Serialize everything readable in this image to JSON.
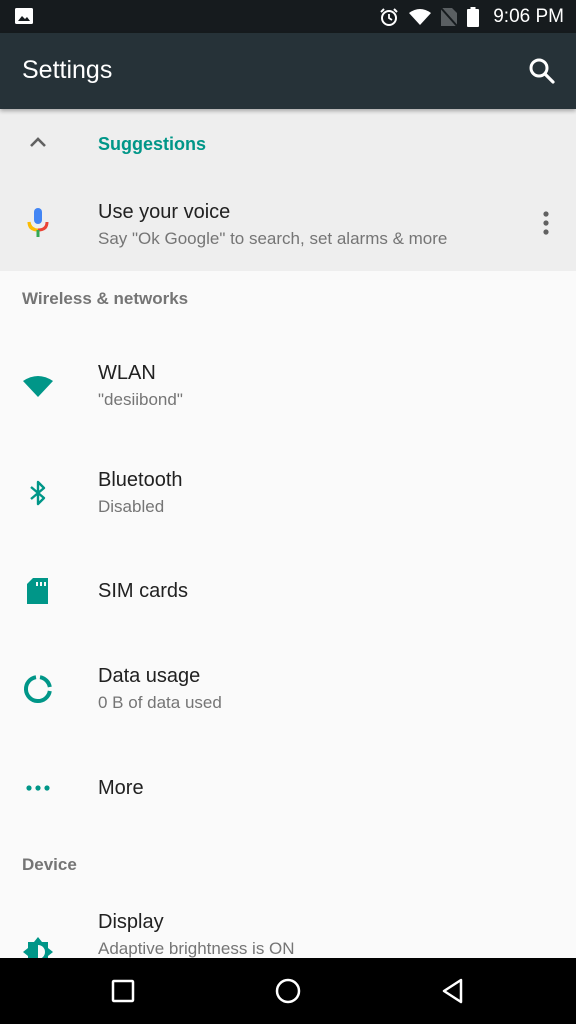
{
  "status_bar": {
    "time": "9:06 PM",
    "icons": [
      "image-notification-icon",
      "alarm-icon",
      "wifi-icon",
      "no-sim-icon",
      "battery-icon"
    ]
  },
  "app_bar": {
    "title": "Settings",
    "search_icon": "search-icon"
  },
  "suggestions": {
    "header": "Suggestions",
    "collapse_icon": "chevron-up-icon",
    "items": [
      {
        "title": "Use your voice",
        "summary": "Say \"Ok Google\" to search, set alarms & more",
        "icon": "google-mic-icon",
        "menu_icon": "more-vert-icon"
      }
    ]
  },
  "sections": [
    {
      "header": "Wireless & networks",
      "items": [
        {
          "title": "WLAN",
          "summary": "\"desiibond\"",
          "icon": "wifi-icon"
        },
        {
          "title": "Bluetooth",
          "summary": "Disabled",
          "icon": "bluetooth-icon"
        },
        {
          "title": "SIM cards",
          "summary": "",
          "icon": "sim-card-icon"
        },
        {
          "title": "Data usage",
          "summary": "0 B of data used",
          "icon": "data-usage-icon"
        },
        {
          "title": "More",
          "summary": "",
          "icon": "more-horiz-icon"
        }
      ]
    },
    {
      "header": "Device",
      "items": [
        {
          "title": "Display",
          "summary": "Adaptive brightness is ON",
          "icon": "brightness-icon"
        }
      ]
    }
  ],
  "nav_bar": {
    "buttons": [
      "recents",
      "home",
      "back"
    ]
  },
  "colors": {
    "accent": "#009688",
    "app_bar": "#263238",
    "status_bar": "#161b1e",
    "suggestions_bg": "#eeeeee",
    "background": "#fafafa"
  }
}
